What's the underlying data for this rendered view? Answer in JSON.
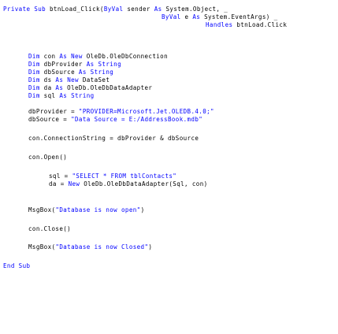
{
  "code": {
    "lines": [
      {
        "id": "l1",
        "tokens": [
          {
            "k": "kw",
            "t": "Private"
          },
          {
            "k": "tx",
            "t": " "
          },
          {
            "k": "kw",
            "t": "Sub"
          },
          {
            "k": "tx",
            "t": " btnLoad_Click("
          },
          {
            "k": "kw",
            "t": "ByVal"
          },
          {
            "k": "tx",
            "t": " sender "
          },
          {
            "k": "kw",
            "t": "As"
          },
          {
            "k": "tx",
            "t": " System.Object, _"
          }
        ]
      },
      {
        "id": "l2",
        "tokens": [
          {
            "k": "kw",
            "t": "ByVal"
          },
          {
            "k": "tx",
            "t": " e "
          },
          {
            "k": "kw",
            "t": "As"
          },
          {
            "k": "tx",
            "t": " System.EventArgs) _"
          }
        ]
      },
      {
        "id": "l3",
        "tokens": [
          {
            "k": "kw",
            "t": "Handles"
          },
          {
            "k": "tx",
            "t": " btnLoad.Click"
          }
        ]
      },
      {
        "id": "l4",
        "tokens": [
          {
            "k": "kw",
            "t": "Dim"
          },
          {
            "k": "tx",
            "t": " con "
          },
          {
            "k": "kw",
            "t": "As"
          },
          {
            "k": "tx",
            "t": " "
          },
          {
            "k": "kw",
            "t": "New"
          },
          {
            "k": "tx",
            "t": " OleDb.OleDbConnection"
          }
        ]
      },
      {
        "id": "l5",
        "tokens": [
          {
            "k": "kw",
            "t": "Dim"
          },
          {
            "k": "tx",
            "t": " dbProvider "
          },
          {
            "k": "kw",
            "t": "As"
          },
          {
            "k": "tx",
            "t": " "
          },
          {
            "k": "kw",
            "t": "String"
          }
        ]
      },
      {
        "id": "l6",
        "tokens": [
          {
            "k": "kw",
            "t": "Dim"
          },
          {
            "k": "tx",
            "t": " dbSource "
          },
          {
            "k": "kw",
            "t": "As"
          },
          {
            "k": "tx",
            "t": " "
          },
          {
            "k": "kw",
            "t": "String"
          }
        ]
      },
      {
        "id": "l7",
        "tokens": [
          {
            "k": "kw",
            "t": "Dim"
          },
          {
            "k": "tx",
            "t": " ds "
          },
          {
            "k": "kw",
            "t": "As"
          },
          {
            "k": "tx",
            "t": " "
          },
          {
            "k": "kw",
            "t": "New"
          },
          {
            "k": "tx",
            "t": " DataSet"
          }
        ]
      },
      {
        "id": "l8",
        "tokens": [
          {
            "k": "kw",
            "t": "Dim"
          },
          {
            "k": "tx",
            "t": " da "
          },
          {
            "k": "kw",
            "t": "As"
          },
          {
            "k": "tx",
            "t": " OleDb.OleDbDataAdapter"
          }
        ]
      },
      {
        "id": "l9",
        "tokens": [
          {
            "k": "kw",
            "t": "Dim"
          },
          {
            "k": "tx",
            "t": " sql "
          },
          {
            "k": "kw",
            "t": "As"
          },
          {
            "k": "tx",
            "t": " "
          },
          {
            "k": "kw",
            "t": "String"
          }
        ]
      },
      {
        "id": "l10",
        "tokens": [
          {
            "k": "tx",
            "t": "dbProvider = "
          },
          {
            "k": "kw",
            "t": "\"PROVIDER=Microsoft.Jet.OLEDB.4.0;\""
          }
        ]
      },
      {
        "id": "l11",
        "tokens": [
          {
            "k": "tx",
            "t": "dbSource = "
          },
          {
            "k": "kw",
            "t": "\"Data Source = E:/AddressBook.mdb\""
          }
        ]
      },
      {
        "id": "l12",
        "tokens": [
          {
            "k": "tx",
            "t": "con.ConnectionString = dbProvider & dbSource"
          }
        ]
      },
      {
        "id": "l13",
        "tokens": [
          {
            "k": "tx",
            "t": "con.Open()"
          }
        ]
      },
      {
        "id": "l14",
        "tokens": [
          {
            "k": "tx",
            "t": "sql = "
          },
          {
            "k": "kw",
            "t": "\"SELECT * FROM tblContacts\""
          }
        ]
      },
      {
        "id": "l15",
        "tokens": [
          {
            "k": "tx",
            "t": "da = "
          },
          {
            "k": "kw",
            "t": "New"
          },
          {
            "k": "tx",
            "t": " OleDb.OleDbDataAdapter(Sql, con)"
          }
        ]
      },
      {
        "id": "l16",
        "tokens": [
          {
            "k": "tx",
            "t": "MsgBox("
          },
          {
            "k": "kw",
            "t": "\"Database is now open\""
          },
          {
            "k": "tx",
            "t": ")"
          }
        ]
      },
      {
        "id": "l17",
        "tokens": [
          {
            "k": "tx",
            "t": "con.Close()"
          }
        ]
      },
      {
        "id": "l18",
        "tokens": [
          {
            "k": "tx",
            "t": "MsgBox("
          },
          {
            "k": "kw",
            "t": "\"Database is now Closed\""
          },
          {
            "k": "tx",
            "t": ")"
          }
        ]
      },
      {
        "id": "l19",
        "tokens": [
          {
            "k": "kw",
            "t": "End"
          },
          {
            "k": "tx",
            "t": " "
          },
          {
            "k": "kw",
            "t": "Sub"
          }
        ]
      }
    ]
  },
  "colors": {
    "keyword": "#0000ff",
    "text": "#000000",
    "background": "#ffffff"
  }
}
